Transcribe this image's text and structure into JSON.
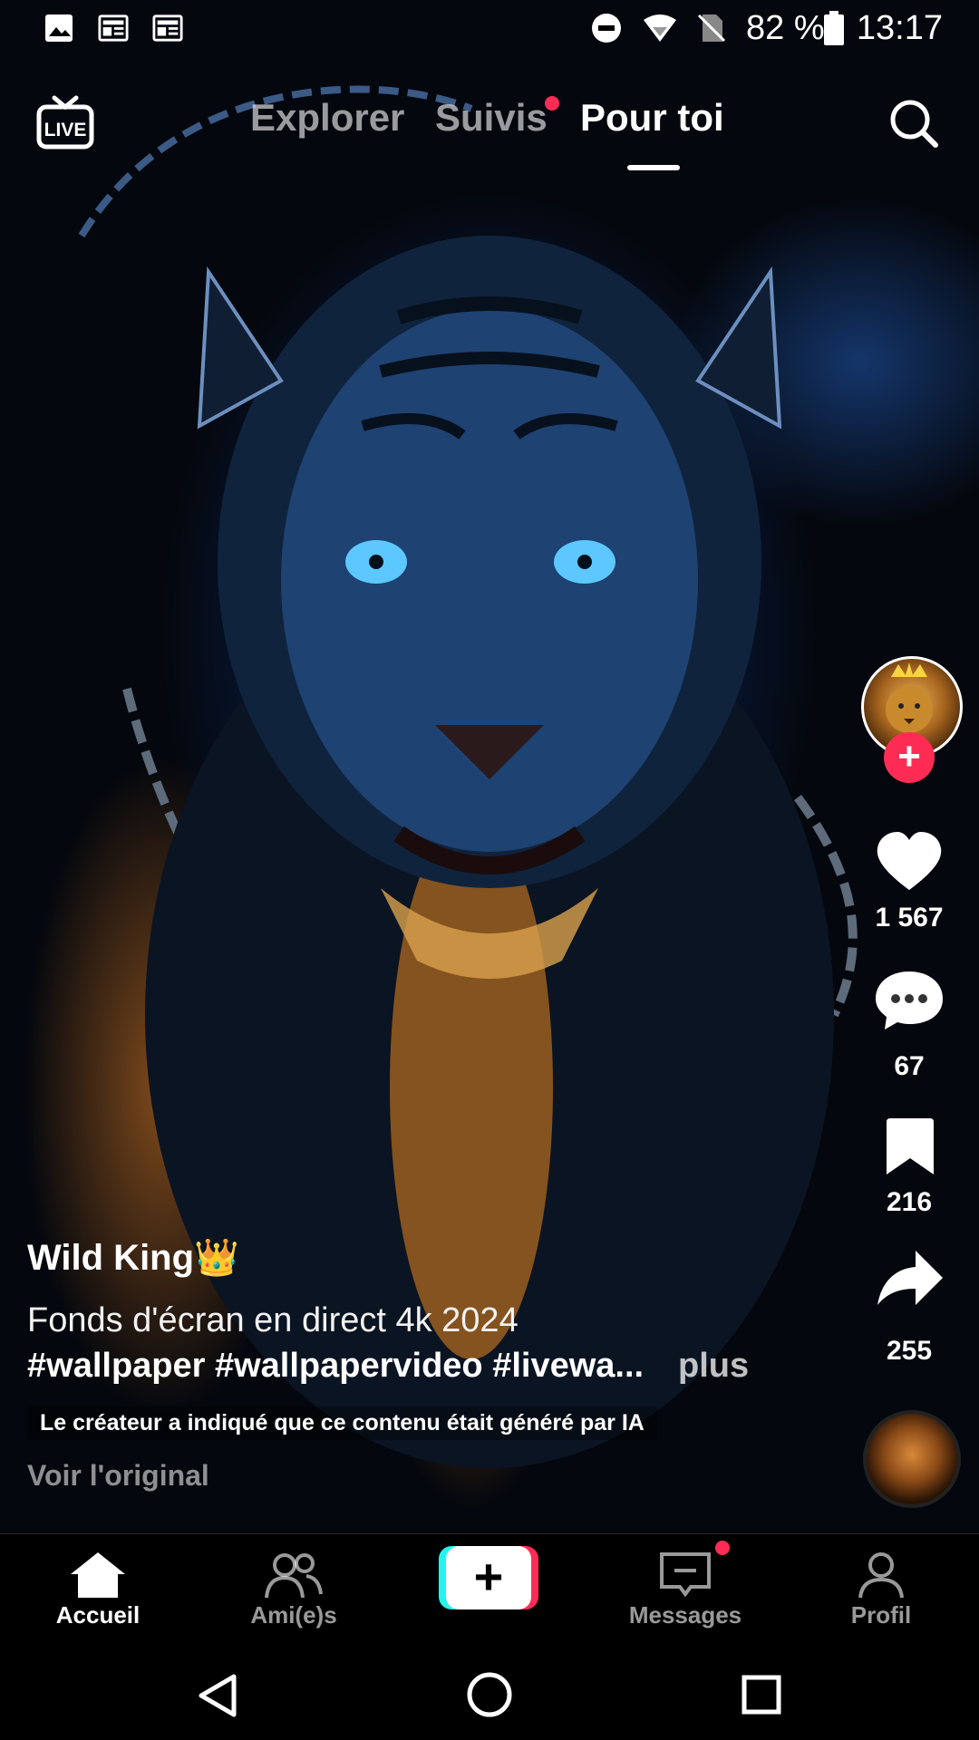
{
  "status_bar": {
    "battery": "82 %",
    "time": "13:17",
    "icons": [
      "image-icon",
      "news-icon",
      "news-icon",
      "do-not-disturb-icon",
      "wifi-icon",
      "no-sim-icon",
      "battery-icon"
    ]
  },
  "top_nav": {
    "live_label": "LIVE",
    "tabs": [
      {
        "label": "Explorer",
        "active": false
      },
      {
        "label": "Suivis",
        "active": false,
        "has_dot": true
      },
      {
        "label": "Pour toi",
        "active": true
      }
    ]
  },
  "actions": {
    "likes": "1 567",
    "comments": "67",
    "saves": "216",
    "shares": "255",
    "follow_symbol": "+"
  },
  "post": {
    "author": "Wild King👑",
    "caption": "Fonds d'écran en direct 4k 2024",
    "hashtags": "#wallpaper #wallpapervideo #livewa...",
    "more_label": "plus",
    "ai_label": "Le créateur a indiqué que ce contenu était généré par IA",
    "see_original": "Voir l'original"
  },
  "bottom_nav": {
    "items": [
      {
        "label": "Accueil",
        "active": true
      },
      {
        "label": "Ami(e)s",
        "active": false
      },
      {
        "label": "+",
        "active": false
      },
      {
        "label": "Messages",
        "active": false,
        "has_dot": true
      },
      {
        "label": "Profil",
        "active": false
      }
    ]
  },
  "colors": {
    "accent": "#fe2c55",
    "cyan": "#25f4ee",
    "background": "#000000"
  }
}
